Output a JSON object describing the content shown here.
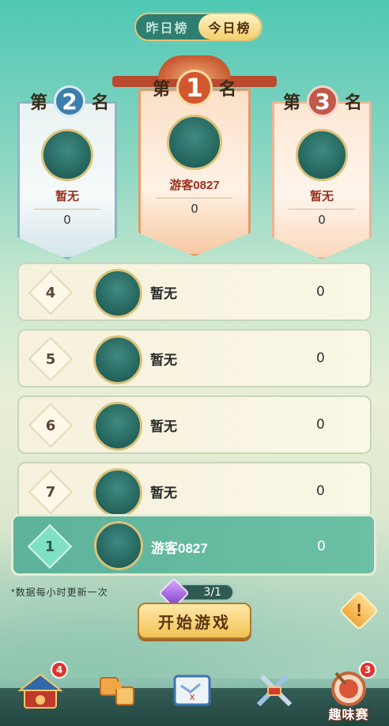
{
  "tabs": {
    "yesterday": "昨日榜",
    "today": "今日榜"
  },
  "podium": {
    "word_di": "第",
    "word_ming": "名",
    "second": {
      "rank": "2",
      "name": "暂无",
      "score": "0"
    },
    "first": {
      "rank": "1",
      "name": "游客0827",
      "score": "0"
    },
    "third": {
      "rank": "3",
      "name": "暂无",
      "score": "0"
    }
  },
  "list": [
    {
      "rank": "4",
      "name": "暂无",
      "score": "0"
    },
    {
      "rank": "5",
      "name": "暂无",
      "score": "0"
    },
    {
      "rank": "6",
      "name": "暂无",
      "score": "0"
    },
    {
      "rank": "7",
      "name": "暂无",
      "score": "0"
    }
  ],
  "my_rank": {
    "rank": "1",
    "name": "游客0827",
    "score": "0"
  },
  "footer": {
    "note": "*数据每小时更新一次",
    "progress": "3/1",
    "start_button": "开始游戏",
    "warn": "!"
  },
  "nav": {
    "badges": {
      "item1": "4",
      "fun": "3"
    },
    "fun_label": "趣味赛"
  },
  "colors": {
    "accent": "#2f7e71",
    "highlight_row": "#5db39a",
    "start_button": "#f2c254"
  }
}
